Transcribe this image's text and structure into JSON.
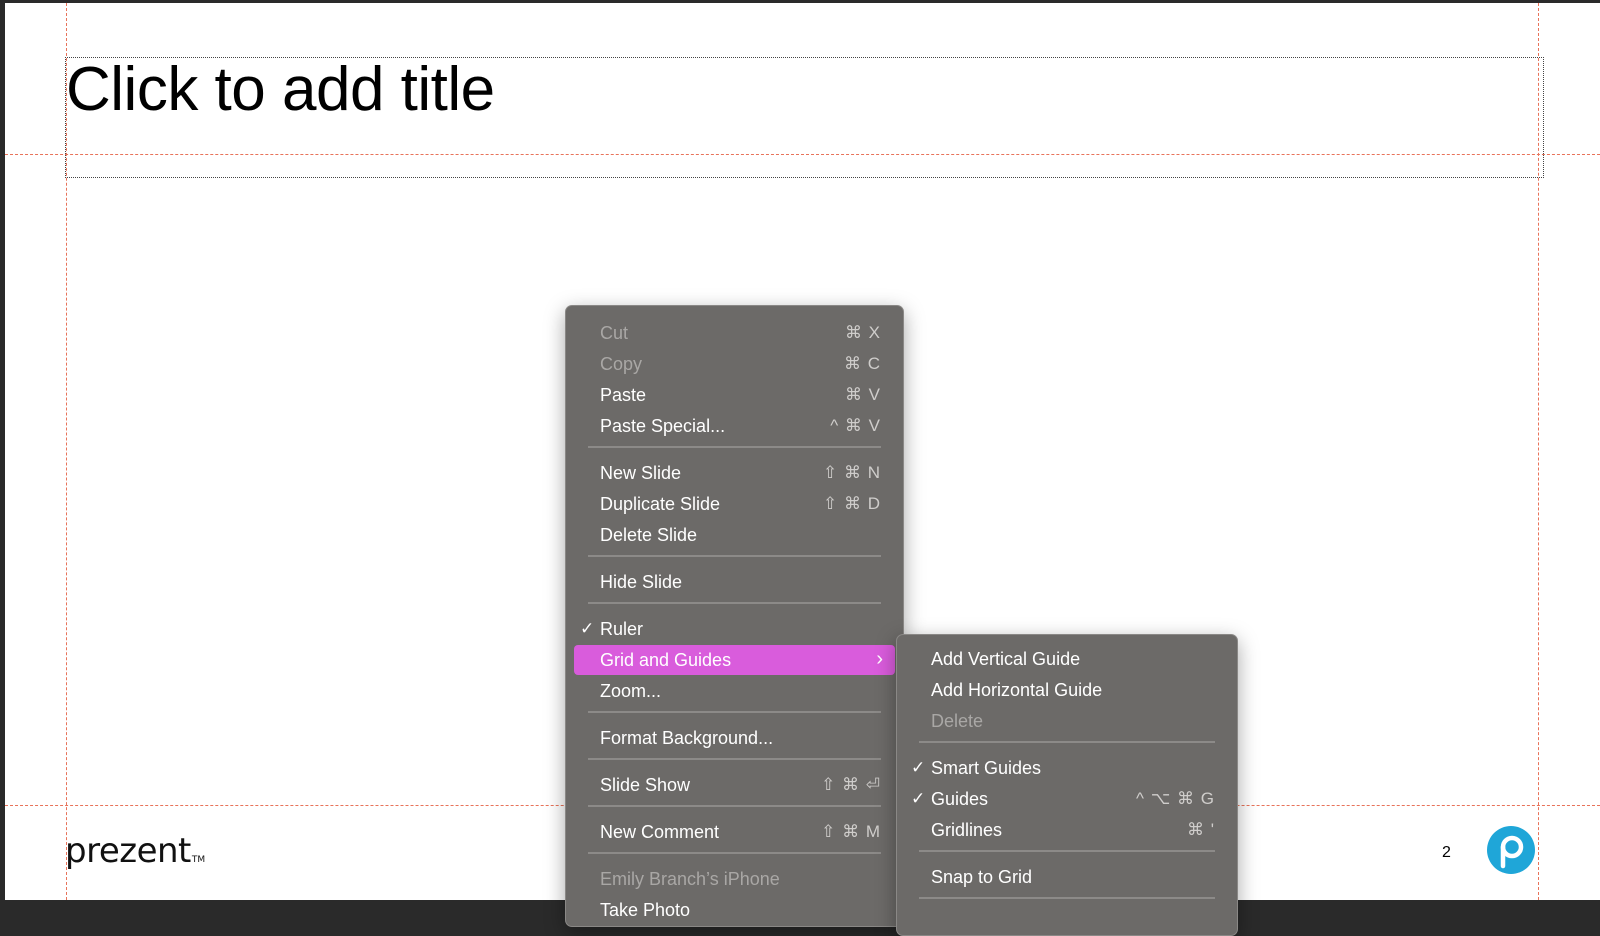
{
  "slide": {
    "title_placeholder": "Click to add title",
    "logo_text": "prezent",
    "logo_tm": "TM",
    "page_number": "2",
    "guide_color": "#e8735a"
  },
  "context_menu": {
    "items": [
      {
        "label": "Cut",
        "shortcut": "⌘ X",
        "disabled": true
      },
      {
        "label": "Copy",
        "shortcut": "⌘ C",
        "disabled": true
      },
      {
        "label": "Paste",
        "shortcut": "⌘ V"
      },
      {
        "label": "Paste Special...",
        "shortcut": "^ ⌘ V"
      },
      {
        "label": "New Slide",
        "shortcut": "⇧ ⌘ N"
      },
      {
        "label": "Duplicate Slide",
        "shortcut": "⇧ ⌘ D"
      },
      {
        "label": "Delete Slide",
        "shortcut": ""
      },
      {
        "label": "Hide Slide",
        "shortcut": ""
      },
      {
        "label": "Ruler",
        "shortcut": "",
        "checked": true
      },
      {
        "label": "Grid and Guides",
        "shortcut": "",
        "submenu": true,
        "highlighted": true
      },
      {
        "label": "Zoom...",
        "shortcut": ""
      },
      {
        "label": "Format Background...",
        "shortcut": ""
      },
      {
        "label": "Slide Show",
        "shortcut": "⇧ ⌘ ⏎"
      },
      {
        "label": "New Comment",
        "shortcut": "⇧ ⌘ M"
      },
      {
        "label": "Emily Branch’s iPhone",
        "shortcut": "",
        "disabled": true
      },
      {
        "label": "Take Photo",
        "shortcut": ""
      }
    ],
    "highlight_color": "#d95cdc"
  },
  "submenu": {
    "items": [
      {
        "label": "Add Vertical Guide",
        "shortcut": ""
      },
      {
        "label": "Add Horizontal Guide",
        "shortcut": ""
      },
      {
        "label": "Delete",
        "shortcut": "",
        "disabled": true
      },
      {
        "label": "Smart Guides",
        "shortcut": "",
        "checked": true
      },
      {
        "label": "Guides",
        "shortcut": "^ ⌥ ⌘ G",
        "checked": true
      },
      {
        "label": "Gridlines",
        "shortcut": "⌘ '"
      },
      {
        "label": "Snap to Grid",
        "shortcut": ""
      }
    ]
  },
  "icons": {
    "check": "checkmark-icon",
    "submenu_arrow": "chevron-right-icon",
    "badge": "prezent-p-logo-icon"
  }
}
